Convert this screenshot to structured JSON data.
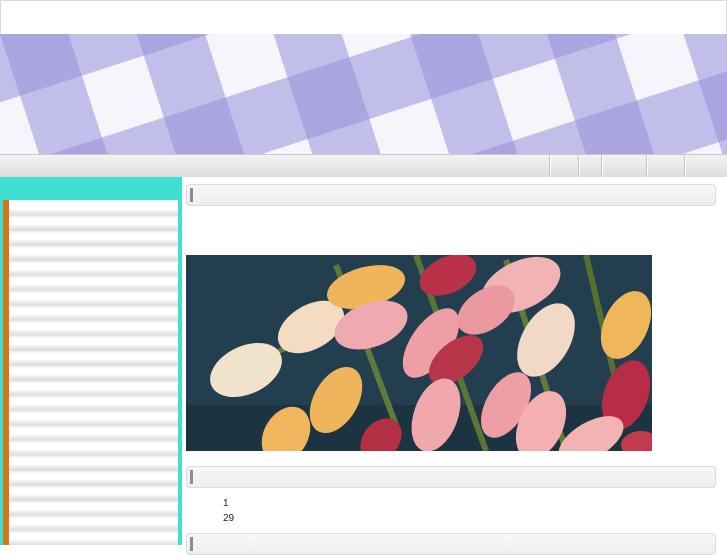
{
  "theme": {
    "accent": "#40e0d0",
    "sidebar_accent": "#d8731f",
    "banner_check": "#8f8ad8"
  },
  "banner": {
    "pattern": "gingham-check"
  },
  "hero": {
    "subject": "tulips"
  },
  "stats": {
    "value_1": "1",
    "value_2": "29"
  }
}
